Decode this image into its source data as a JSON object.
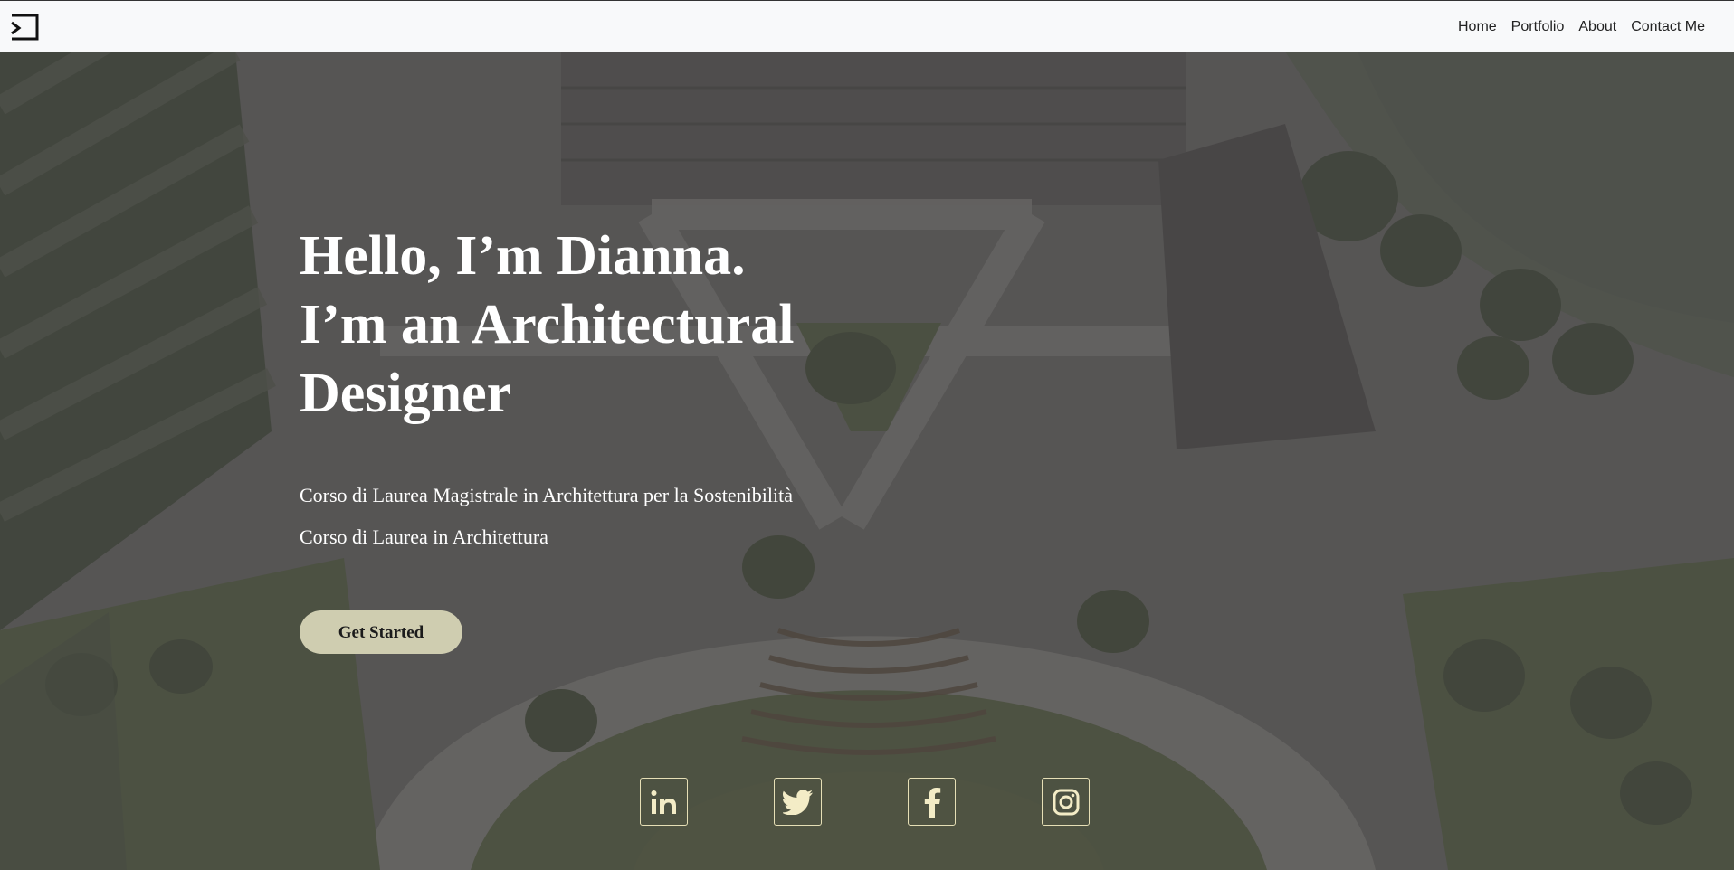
{
  "nav": {
    "logo_icon": "bracket-logo-icon",
    "links": [
      "Home",
      "Portfolio",
      "About",
      "Contact Me"
    ]
  },
  "hero": {
    "headline": [
      "Hello, I’m Dianna.",
      "I’m an Architectural",
      "Designer"
    ],
    "subtitles": [
      "Corso di Laurea Magistrale in Architettura per la Sostenibilità",
      "Corso di Laurea in Architettura"
    ],
    "cta_label": "Get Started",
    "background_image": "aerial-architectural-plaza-render"
  },
  "socials": [
    "linkedin-icon",
    "twitter-icon",
    "facebook-icon",
    "instagram-icon"
  ],
  "colors": {
    "nav_bg": "#f8f9fa",
    "cta_bg": "#cfcdb0",
    "social_border": "#e6dfb6",
    "overlay": "#464446"
  }
}
